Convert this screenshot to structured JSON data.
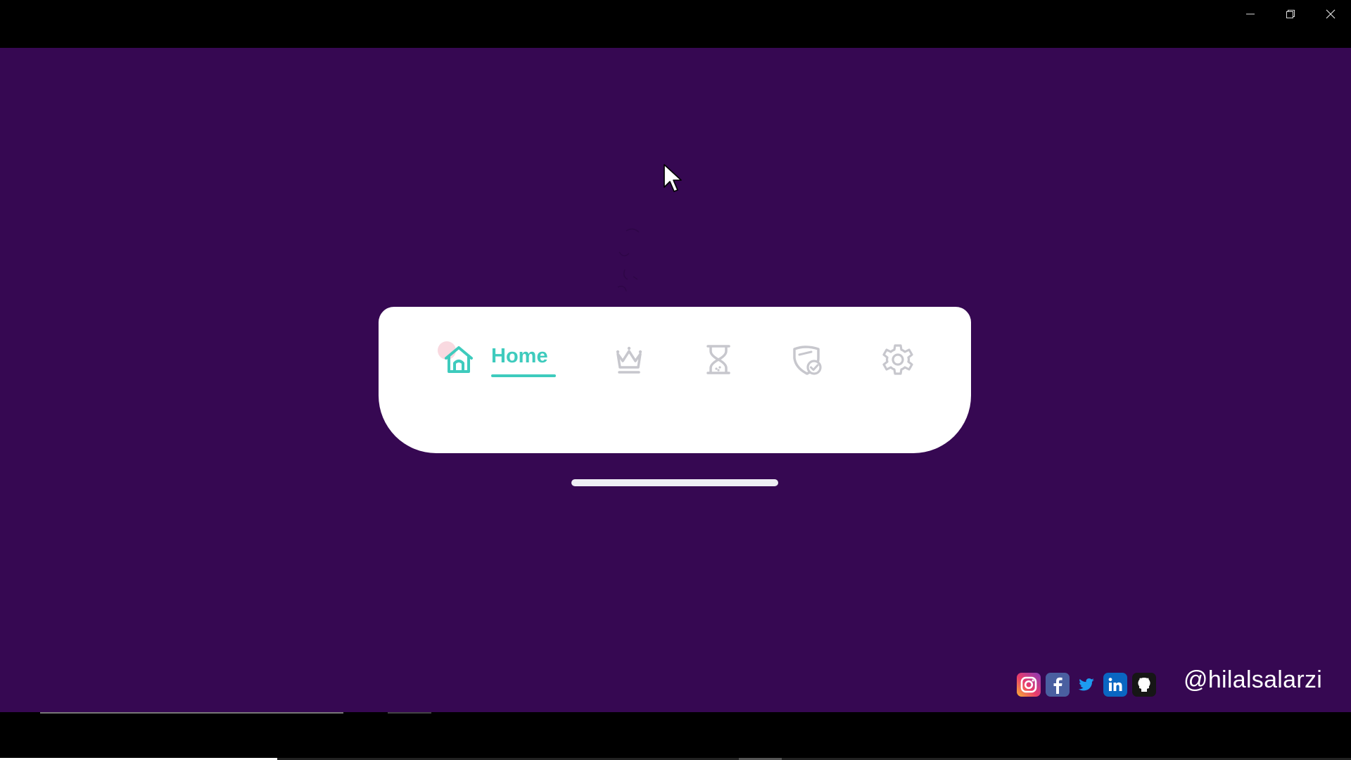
{
  "window": {
    "controls": [
      "minimize",
      "restore",
      "close"
    ]
  },
  "navbar": {
    "active_item": "home",
    "items": [
      {
        "id": "home",
        "label": "Home",
        "icon": "home-icon",
        "active": true
      },
      {
        "id": "crown",
        "label": "",
        "icon": "crown-icon",
        "active": false
      },
      {
        "id": "hourglass",
        "label": "",
        "icon": "hourglass-icon",
        "active": false
      },
      {
        "id": "shield",
        "label": "",
        "icon": "shield-check-icon",
        "active": false
      },
      {
        "id": "settings",
        "label": "",
        "icon": "gear-icon",
        "active": false
      }
    ]
  },
  "social": {
    "icons": [
      "instagram-icon",
      "facebook-icon",
      "twitter-icon",
      "linkedin-icon",
      "github-icon"
    ],
    "handle": "@hilalsalarzi"
  },
  "player": {
    "progress": 0.205
  },
  "colors": {
    "background": "#360852",
    "accent": "#3ecbbd",
    "inactive_icon": "#c7c7cd",
    "navbar": "#ffffff"
  }
}
